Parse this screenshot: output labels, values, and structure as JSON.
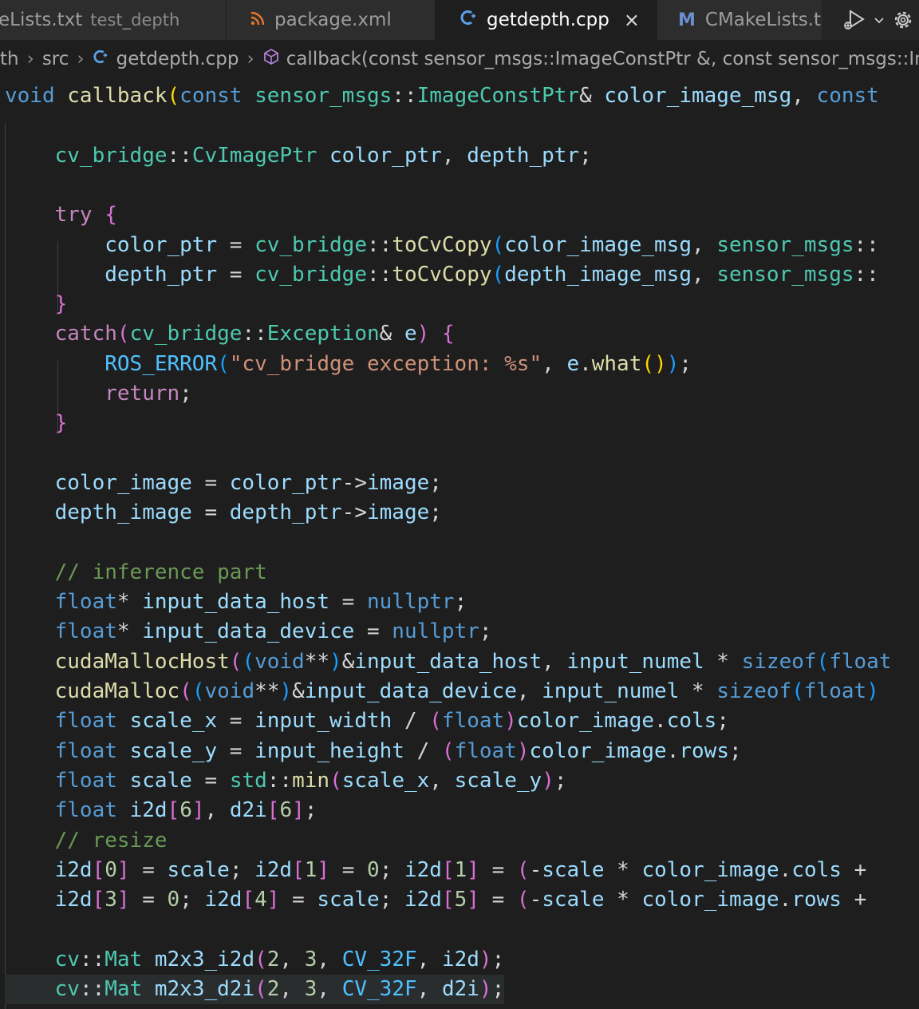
{
  "tabs": [
    {
      "label": "eLists.txt",
      "subtitle": "test_depth",
      "icon": "cmake-file-icon",
      "active": false
    },
    {
      "label": "package.xml",
      "icon": "rss-icon",
      "active": false
    },
    {
      "label": "getdepth.cpp",
      "icon": "cpp-file-icon",
      "active": true,
      "close": "×"
    },
    {
      "label": "CMakeLists.t",
      "icon": "cmake-m-icon",
      "active": false
    }
  ],
  "breadcrumb": {
    "items": [
      "th",
      "src",
      "getdepth.cpp",
      "callback(const sensor_msgs::ImageConstPtr &, const sensor_msgs::ImageConstPtr &)"
    ]
  },
  "code": {
    "lines": [
      [
        [
          "void",
          "kw"
        ],
        [
          " ",
          ""
        ],
        [
          "callback",
          "fn"
        ],
        [
          "(",
          "br1"
        ],
        [
          "const",
          "kw"
        ],
        [
          " ",
          ""
        ],
        [
          "sensor_msgs",
          "type"
        ],
        [
          "::",
          ""
        ],
        [
          "ImageConstPtr",
          "type"
        ],
        [
          "& ",
          ""
        ],
        [
          "color_image_msg",
          "var"
        ],
        [
          ", ",
          ""
        ],
        [
          "const",
          "kw"
        ]
      ],
      [],
      [
        [
          "    ",
          ""
        ],
        [
          "cv_bridge",
          "type"
        ],
        [
          "::",
          ""
        ],
        [
          "CvImagePtr",
          "type"
        ],
        [
          " ",
          ""
        ],
        [
          "color_ptr",
          "var"
        ],
        [
          ", ",
          ""
        ],
        [
          "depth_ptr",
          "var"
        ],
        [
          ";",
          ""
        ]
      ],
      [],
      [
        [
          "    ",
          ""
        ],
        [
          "try",
          "ctl"
        ],
        [
          " ",
          ""
        ],
        [
          "{",
          "br2"
        ]
      ],
      [
        [
          "        ",
          ""
        ],
        [
          "color_ptr",
          "var"
        ],
        [
          " = ",
          ""
        ],
        [
          "cv_bridge",
          "type"
        ],
        [
          "::",
          ""
        ],
        [
          "toCvCopy",
          "fn"
        ],
        [
          "(",
          "br3"
        ],
        [
          "color_image_msg",
          "var"
        ],
        [
          ", ",
          ""
        ],
        [
          "sensor_msgs",
          "type"
        ],
        [
          "::",
          ""
        ]
      ],
      [
        [
          "        ",
          ""
        ],
        [
          "depth_ptr",
          "var"
        ],
        [
          " = ",
          ""
        ],
        [
          "cv_bridge",
          "type"
        ],
        [
          "::",
          ""
        ],
        [
          "toCvCopy",
          "fn"
        ],
        [
          "(",
          "br3"
        ],
        [
          "depth_image_msg",
          "var"
        ],
        [
          ", ",
          ""
        ],
        [
          "sensor_msgs",
          "type"
        ],
        [
          "::",
          ""
        ]
      ],
      [
        [
          "    ",
          ""
        ],
        [
          "}",
          "br2"
        ]
      ],
      [
        [
          "    ",
          ""
        ],
        [
          "catch",
          "ctl"
        ],
        [
          "(",
          "br2"
        ],
        [
          "cv_bridge",
          "type"
        ],
        [
          "::",
          ""
        ],
        [
          "Exception",
          "type"
        ],
        [
          "& ",
          ""
        ],
        [
          "e",
          "var"
        ],
        [
          ")",
          "br2"
        ],
        [
          " ",
          ""
        ],
        [
          "{",
          "br2"
        ]
      ],
      [
        [
          "        ",
          ""
        ],
        [
          "ROS_ERROR",
          "mac"
        ],
        [
          "(",
          "br3"
        ],
        [
          "\"cv_bridge exception: %s\"",
          "str"
        ],
        [
          ", ",
          ""
        ],
        [
          "e",
          "var"
        ],
        [
          ".",
          ""
        ],
        [
          "what",
          "fn"
        ],
        [
          "()",
          "br1"
        ],
        [
          ")",
          "br3"
        ],
        [
          ";",
          ""
        ]
      ],
      [
        [
          "        ",
          ""
        ],
        [
          "return",
          "ctl"
        ],
        [
          ";",
          ""
        ]
      ],
      [
        [
          "    ",
          ""
        ],
        [
          "}",
          "br2"
        ]
      ],
      [],
      [
        [
          "    ",
          ""
        ],
        [
          "color_image",
          "var"
        ],
        [
          " = ",
          ""
        ],
        [
          "color_ptr",
          "var"
        ],
        [
          "->",
          ""
        ],
        [
          "image",
          "var"
        ],
        [
          ";",
          ""
        ]
      ],
      [
        [
          "    ",
          ""
        ],
        [
          "depth_image",
          "var"
        ],
        [
          " = ",
          ""
        ],
        [
          "depth_ptr",
          "var"
        ],
        [
          "->",
          ""
        ],
        [
          "image",
          "var"
        ],
        [
          ";",
          ""
        ]
      ],
      [],
      [
        [
          "    ",
          ""
        ],
        [
          "// inference part",
          "com"
        ]
      ],
      [
        [
          "    ",
          ""
        ],
        [
          "float",
          "kw"
        ],
        [
          "* ",
          ""
        ],
        [
          "input_data_host",
          "var"
        ],
        [
          " = ",
          ""
        ],
        [
          "nullptr",
          "kw"
        ],
        [
          ";",
          ""
        ]
      ],
      [
        [
          "    ",
          ""
        ],
        [
          "float",
          "kw"
        ],
        [
          "* ",
          ""
        ],
        [
          "input_data_device",
          "var"
        ],
        [
          " = ",
          ""
        ],
        [
          "nullptr",
          "kw"
        ],
        [
          ";",
          ""
        ]
      ],
      [
        [
          "    ",
          ""
        ],
        [
          "cudaMallocHost",
          "fn"
        ],
        [
          "(",
          "br2"
        ],
        [
          "(",
          "br3"
        ],
        [
          "void",
          "kw"
        ],
        [
          "**",
          ""
        ],
        [
          ")",
          "br3"
        ],
        [
          "&",
          ""
        ],
        [
          "input_data_host",
          "var"
        ],
        [
          ", ",
          ""
        ],
        [
          "input_numel",
          "var"
        ],
        [
          " * ",
          ""
        ],
        [
          "sizeof",
          "kw"
        ],
        [
          "(",
          "br3"
        ],
        [
          "float",
          "kw"
        ]
      ],
      [
        [
          "    ",
          ""
        ],
        [
          "cudaMalloc",
          "fn"
        ],
        [
          "(",
          "br2"
        ],
        [
          "(",
          "br3"
        ],
        [
          "void",
          "kw"
        ],
        [
          "**",
          ""
        ],
        [
          ")",
          "br3"
        ],
        [
          "&",
          ""
        ],
        [
          "input_data_device",
          "var"
        ],
        [
          ", ",
          ""
        ],
        [
          "input_numel",
          "var"
        ],
        [
          " * ",
          ""
        ],
        [
          "sizeof",
          "kw"
        ],
        [
          "(",
          "br3"
        ],
        [
          "float",
          "kw"
        ],
        [
          ")",
          "br3"
        ]
      ],
      [
        [
          "    ",
          ""
        ],
        [
          "float",
          "kw"
        ],
        [
          " ",
          ""
        ],
        [
          "scale_x",
          "var"
        ],
        [
          " = ",
          ""
        ],
        [
          "input_width",
          "var"
        ],
        [
          " / ",
          ""
        ],
        [
          "(",
          "br2"
        ],
        [
          "float",
          "kw"
        ],
        [
          ")",
          "br2"
        ],
        [
          "color_image",
          "var"
        ],
        [
          ".",
          ""
        ],
        [
          "cols",
          "var"
        ],
        [
          ";",
          ""
        ]
      ],
      [
        [
          "    ",
          ""
        ],
        [
          "float",
          "kw"
        ],
        [
          " ",
          ""
        ],
        [
          "scale_y",
          "var"
        ],
        [
          " = ",
          ""
        ],
        [
          "input_height",
          "var"
        ],
        [
          " / ",
          ""
        ],
        [
          "(",
          "br2"
        ],
        [
          "float",
          "kw"
        ],
        [
          ")",
          "br2"
        ],
        [
          "color_image",
          "var"
        ],
        [
          ".",
          ""
        ],
        [
          "rows",
          "var"
        ],
        [
          ";",
          ""
        ]
      ],
      [
        [
          "    ",
          ""
        ],
        [
          "float",
          "kw"
        ],
        [
          " ",
          ""
        ],
        [
          "scale",
          "var"
        ],
        [
          " = ",
          ""
        ],
        [
          "std",
          "type"
        ],
        [
          "::",
          ""
        ],
        [
          "min",
          "fn"
        ],
        [
          "(",
          "br2"
        ],
        [
          "scale_x",
          "var"
        ],
        [
          ", ",
          ""
        ],
        [
          "scale_y",
          "var"
        ],
        [
          ")",
          "br2"
        ],
        [
          ";",
          ""
        ]
      ],
      [
        [
          "    ",
          ""
        ],
        [
          "float",
          "kw"
        ],
        [
          " ",
          ""
        ],
        [
          "i2d",
          "var"
        ],
        [
          "[",
          "br2"
        ],
        [
          "6",
          "num"
        ],
        [
          "]",
          "br2"
        ],
        [
          ", ",
          ""
        ],
        [
          "d2i",
          "var"
        ],
        [
          "[",
          "br2"
        ],
        [
          "6",
          "num"
        ],
        [
          "]",
          "br2"
        ],
        [
          ";",
          ""
        ]
      ],
      [
        [
          "    ",
          ""
        ],
        [
          "// resize",
          "com"
        ]
      ],
      [
        [
          "    ",
          ""
        ],
        [
          "i2d",
          "var"
        ],
        [
          "[",
          "br2"
        ],
        [
          "0",
          "num"
        ],
        [
          "]",
          "br2"
        ],
        [
          " = ",
          ""
        ],
        [
          "scale",
          "var"
        ],
        [
          "; ",
          ""
        ],
        [
          "i2d",
          "var"
        ],
        [
          "[",
          "br2"
        ],
        [
          "1",
          "num"
        ],
        [
          "]",
          "br2"
        ],
        [
          " = ",
          ""
        ],
        [
          "0",
          "num"
        ],
        [
          "; ",
          ""
        ],
        [
          "i2d",
          "var"
        ],
        [
          "[",
          "br2"
        ],
        [
          "1",
          "num"
        ],
        [
          "]",
          "br2"
        ],
        [
          " = ",
          ""
        ],
        [
          "(",
          "br2"
        ],
        [
          "-",
          ""
        ],
        [
          "scale",
          "var"
        ],
        [
          " * ",
          ""
        ],
        [
          "color_image",
          "var"
        ],
        [
          ".",
          ""
        ],
        [
          "cols",
          "var"
        ],
        [
          " +",
          ""
        ]
      ],
      [
        [
          "    ",
          ""
        ],
        [
          "i2d",
          "var"
        ],
        [
          "[",
          "br2"
        ],
        [
          "3",
          "num"
        ],
        [
          "]",
          "br2"
        ],
        [
          " = ",
          ""
        ],
        [
          "0",
          "num"
        ],
        [
          "; ",
          ""
        ],
        [
          "i2d",
          "var"
        ],
        [
          "[",
          "br2"
        ],
        [
          "4",
          "num"
        ],
        [
          "]",
          "br2"
        ],
        [
          " = ",
          ""
        ],
        [
          "scale",
          "var"
        ],
        [
          "; ",
          ""
        ],
        [
          "i2d",
          "var"
        ],
        [
          "[",
          "br2"
        ],
        [
          "5",
          "num"
        ],
        [
          "]",
          "br2"
        ],
        [
          " = ",
          ""
        ],
        [
          "(",
          "br2"
        ],
        [
          "-",
          ""
        ],
        [
          "scale",
          "var"
        ],
        [
          " * ",
          ""
        ],
        [
          "color_image",
          "var"
        ],
        [
          ".",
          ""
        ],
        [
          "rows",
          "var"
        ],
        [
          " +",
          ""
        ]
      ],
      [],
      [
        [
          "    ",
          ""
        ],
        [
          "cv",
          "type"
        ],
        [
          "::",
          ""
        ],
        [
          "Mat",
          "type"
        ],
        [
          " ",
          ""
        ],
        [
          "m2x3_i2d",
          "var"
        ],
        [
          "(",
          "br2"
        ],
        [
          "2",
          "num"
        ],
        [
          ", ",
          ""
        ],
        [
          "3",
          "num"
        ],
        [
          ", ",
          ""
        ],
        [
          "CV_32F",
          "mac"
        ],
        [
          ", ",
          ""
        ],
        [
          "i2d",
          "var"
        ],
        [
          ")",
          "br2"
        ],
        [
          ";",
          ""
        ]
      ],
      [
        [
          "    ",
          ""
        ],
        [
          "cv",
          "type"
        ],
        [
          "::",
          ""
        ],
        [
          "Mat",
          "type"
        ],
        [
          " ",
          ""
        ],
        [
          "m2x3_d2i",
          "var"
        ],
        [
          "(",
          "br2"
        ],
        [
          "2",
          "num"
        ],
        [
          ", ",
          ""
        ],
        [
          "3",
          "num"
        ],
        [
          ", ",
          ""
        ],
        [
          "CV_32F",
          "mac"
        ],
        [
          ", ",
          ""
        ],
        [
          "d2i",
          "var"
        ],
        [
          ")",
          "br2"
        ],
        [
          ";",
          ""
        ]
      ]
    ]
  },
  "colors": {
    "background": "#1e1e1e",
    "keyword": "#569cd6",
    "control": "#c586c0",
    "type": "#4ec9b0",
    "function": "#dcdcaa",
    "variable": "#9cdcfe",
    "string": "#ce9178",
    "number": "#b5cea8",
    "comment": "#6a9955"
  }
}
